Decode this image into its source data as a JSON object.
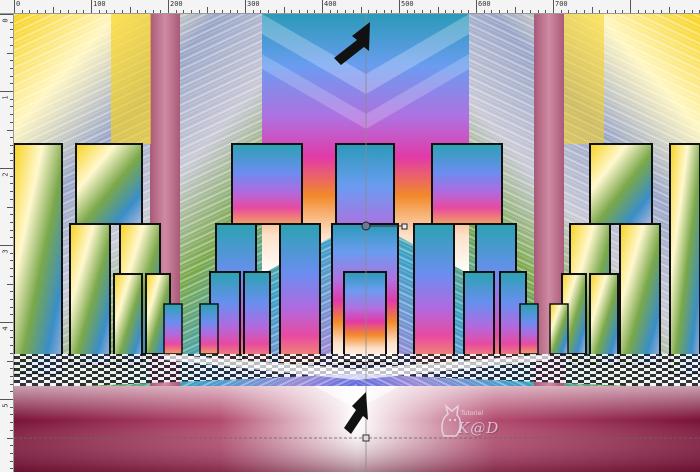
{
  "ruler": {
    "top_labels": [
      "0",
      "100",
      "200",
      "300",
      "400",
      "500",
      "600",
      "700"
    ],
    "left_labels": [
      "0",
      "1",
      "2",
      "3",
      "4",
      "5"
    ]
  },
  "canvas": {
    "guide_color": "#8a8a8a",
    "arrow_color": "#111111",
    "colors": {
      "yellow": "#f7d21c",
      "pink": "#c0708a",
      "blue": "#5a8ef0",
      "purple": "#8a5ae6",
      "magenta": "#e23aa8",
      "orange": "#f28a2a",
      "green": "#6aa04a",
      "teal": "#2aa3b0",
      "floor_maroon": "#8c2046"
    }
  },
  "watermark": {
    "text": "K@D",
    "small_text": "Tutoriel"
  }
}
